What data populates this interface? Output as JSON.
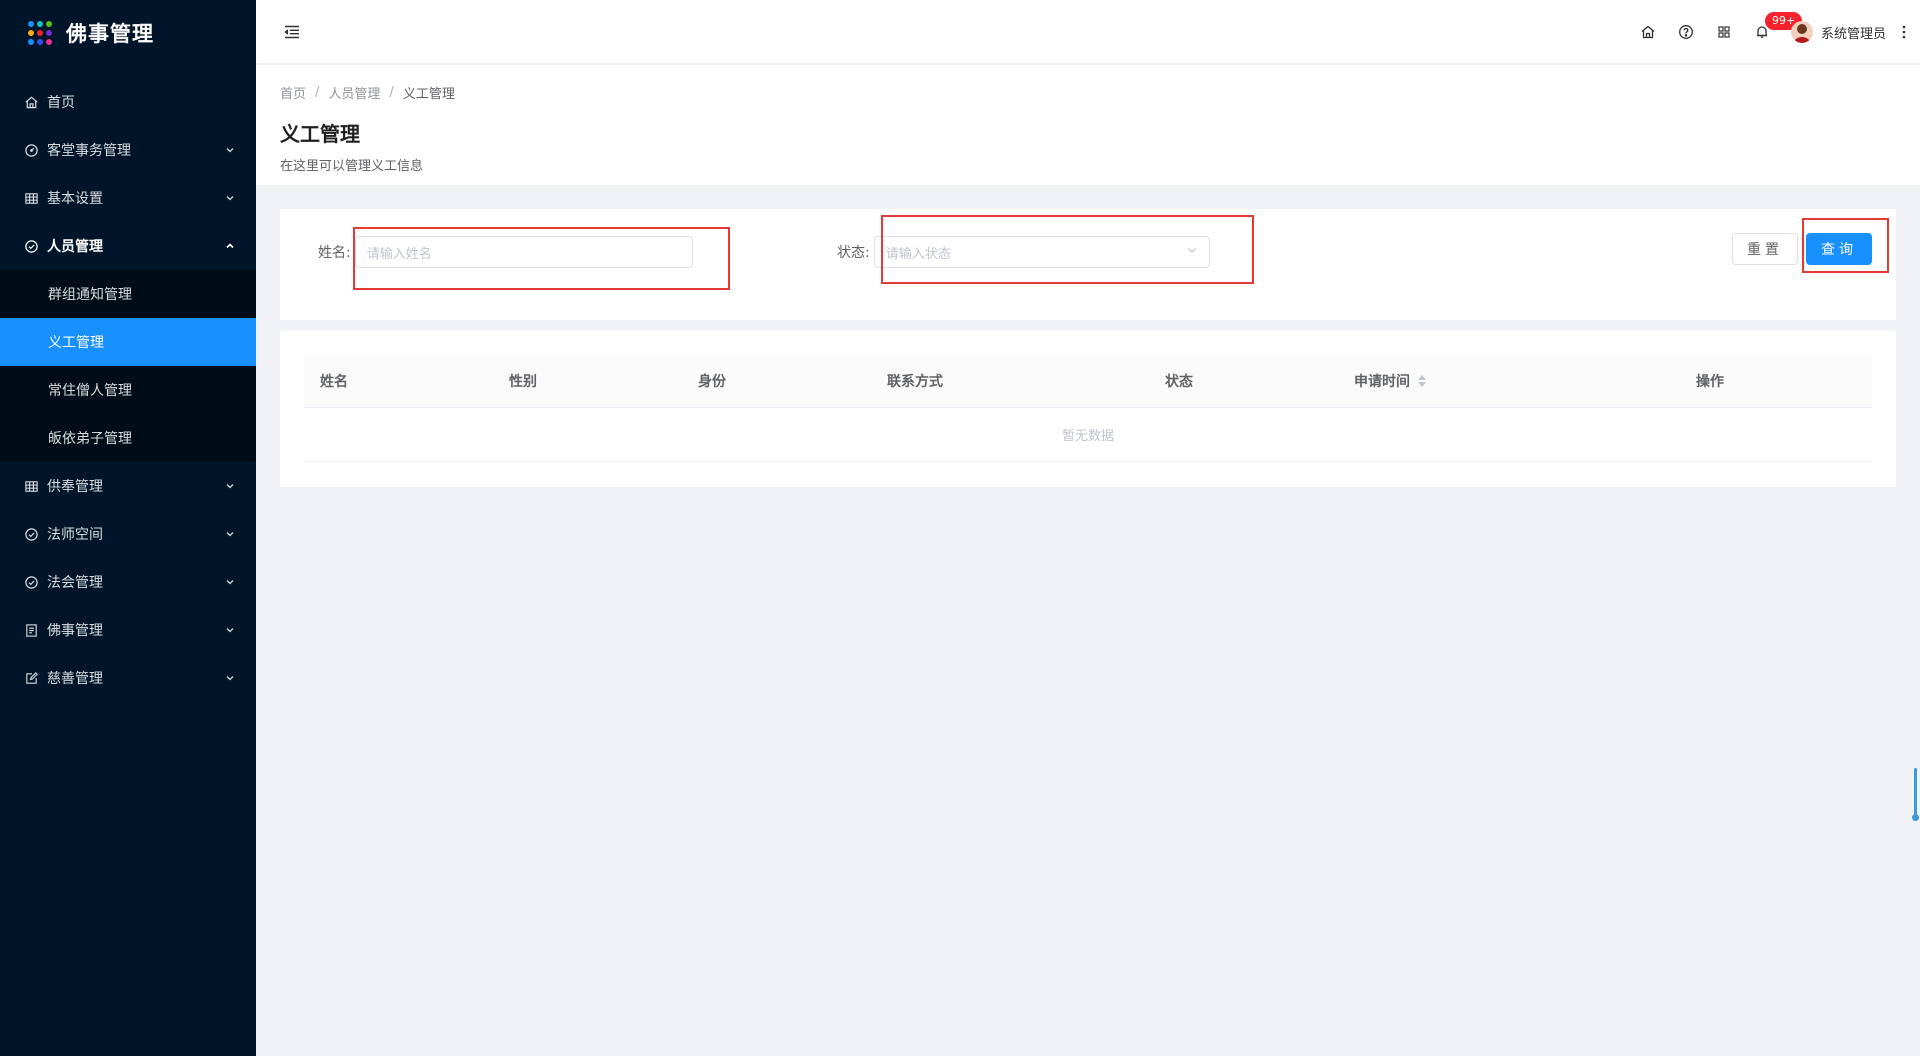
{
  "app": {
    "title": "佛事管理",
    "logo_colors": [
      "#1890ff",
      "#13c2c2",
      "#52c41a",
      "#faad14",
      "#f5222d",
      "#722ed1",
      "#1890ff",
      "#2f54eb",
      "#eb2f96"
    ]
  },
  "sidebar": {
    "items": [
      {
        "label": "首页",
        "icon": "home-icon"
      },
      {
        "label": "客堂事务管理",
        "icon": "dashboard-icon"
      },
      {
        "label": "基本设置",
        "icon": "table-icon"
      },
      {
        "label": "人员管理",
        "icon": "check-circle-icon"
      },
      {
        "label": "供奉管理",
        "icon": "table-icon"
      },
      {
        "label": "法师空间",
        "icon": "check-circle-icon"
      },
      {
        "label": "法会管理",
        "icon": "check-circle-icon"
      },
      {
        "label": "佛事管理",
        "icon": "list-icon"
      },
      {
        "label": "慈善管理",
        "icon": "edit-icon"
      }
    ],
    "submenu": [
      {
        "label": "群组通知管理"
      },
      {
        "label": "义工管理"
      },
      {
        "label": "常住僧人管理"
      },
      {
        "label": "皈依弟子管理"
      }
    ]
  },
  "header": {
    "notification_badge": "99+",
    "user_name": "系统管理员"
  },
  "breadcrumb": [
    "首页",
    "人员管理",
    "义工管理"
  ],
  "page": {
    "title": "义工管理",
    "description": "在这里可以管理义工信息"
  },
  "search": {
    "name_label": "姓名:",
    "name_placeholder": "请输入姓名",
    "status_label": "状态:",
    "status_placeholder": "请输入状态",
    "reset_label": "重置",
    "query_label": "查询"
  },
  "table": {
    "columns": [
      "姓名",
      "性别",
      "身份",
      "联系方式",
      "状态",
      "申请时间",
      "操作"
    ],
    "empty_text": "暂无数据"
  },
  "colors": {
    "sidebar_bg": "#001529",
    "primary": "#1890ff",
    "highlight": "#e53935"
  }
}
